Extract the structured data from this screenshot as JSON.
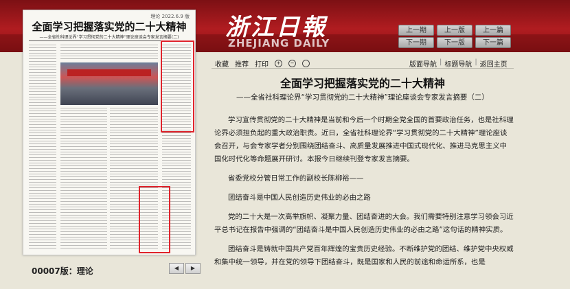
{
  "masthead": {
    "cn": "浙江日報",
    "en": "ZHEJIANG DAILY"
  },
  "nav_buttons": [
    "上一期",
    "上一版",
    "上一篇",
    "下一期",
    "下一版",
    "下一篇"
  ],
  "toolbar": {
    "collect": "收藏",
    "recommend": "推荐",
    "print": "打印"
  },
  "article_nav": {
    "page_nav": "版面导航",
    "title_nav": "标题导航",
    "home": "返回主页"
  },
  "paper": {
    "edition": "理论 2022.6.9 版",
    "title": "全面学习把握落实党的二十大精神",
    "subtitle": "——全省社科理论界“学习贯彻党的二十大精神”理论座谈会专家发言摘要(二)"
  },
  "edition_label": "00007版：理论",
  "pager": {
    "prev": "◀",
    "next": "▶"
  },
  "article": {
    "title": "全面学习把握落实党的二十大精神",
    "subtitle": "——全省社科理论界“学习贯彻党的二十大精神”理论座谈会专家发言摘要（二）",
    "paragraphs": [
      "学习宣传贯彻党的二十大精神是当前和今后一个时期全党全国的首要政治任务，也是社科理论界必须担负起的重大政治职责。近日，全省社科理论界“学习贯彻党的二十大精神”理论座谈会召开，与会专家学者分别围绕团结奋斗、高质量发展推进中国式现代化、推进马克思主义中国化时代化等命题展开研讨。本报今日继续刊登专家发言摘要。",
      "省委党校分管日常工作的副校长陈柳裕——",
      "团结奋斗是中国人民创造历史伟业的必由之路",
      "党的二十大是一次高举旗帜、凝聚力量、团结奋进的大会。我们需要特别注意学习领会习近平总书记在报告中强调的“团结奋斗是中国人民创造历史伟业的必由之路”这句话的精神实质。",
      "团结奋斗是铸就中国共产党百年辉煌的宝贵历史经验。不断维护党的团结、维护党中央权威和集中统一领导，并在党的领导下团结奋斗，既是国家和人民的前途和命运所系，也是"
    ]
  }
}
